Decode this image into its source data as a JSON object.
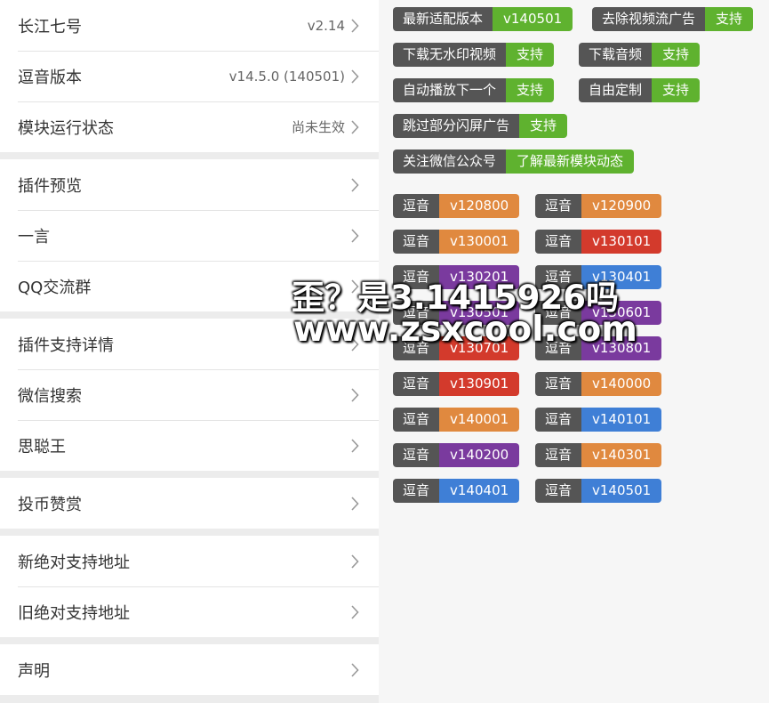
{
  "left_list": {
    "groups": [
      [
        {
          "label": "长江七号",
          "value": "v2.14"
        },
        {
          "label": "逗音版本",
          "value": "v14.5.0 (140501)"
        },
        {
          "label": "模块运行状态",
          "value": "尚未生效"
        }
      ],
      [
        {
          "label": "插件预览",
          "value": ""
        },
        {
          "label": "一言",
          "value": ""
        },
        {
          "label": "QQ交流群",
          "value": ""
        }
      ],
      [
        {
          "label": "插件支持详情",
          "value": ""
        },
        {
          "label": "微信搜索",
          "value": ""
        },
        {
          "label": "思聪王",
          "value": ""
        }
      ],
      [
        {
          "label": "投币赞赏",
          "value": ""
        }
      ],
      [
        {
          "label": "新绝对支持地址",
          "value": ""
        },
        {
          "label": "旧绝对支持地址",
          "value": ""
        }
      ],
      [
        {
          "label": "声明",
          "value": ""
        }
      ]
    ],
    "chevron_icon": "chevron-right-icon"
  },
  "feature_badges": [
    {
      "key": "最新适配版本",
      "value": "v140501",
      "color": "#5fb22f"
    },
    {
      "key": "去除视频流广告",
      "value": "支持",
      "color": "#5fb22f"
    },
    {
      "key": "下载无水印视频",
      "value": "支持",
      "color": "#5fb22f"
    },
    {
      "key": "下载音频",
      "value": "支持",
      "color": "#5fb22f"
    },
    {
      "key": "自动播放下一个",
      "value": "支持",
      "color": "#5fb22f"
    },
    {
      "key": "自由定制",
      "value": "支持",
      "color": "#5fb22f"
    },
    {
      "key": "跳过部分闪屏广告",
      "value": "支持",
      "color": "#5fb22f"
    },
    {
      "key": "关注微信公众号",
      "value": "了解最新模块动态",
      "color": "#5fb22f"
    }
  ],
  "version_badges": [
    {
      "key": "逗音",
      "value": "v120800",
      "color": "#e0893f"
    },
    {
      "key": "逗音",
      "value": "v120900",
      "color": "#e0893f"
    },
    {
      "key": "逗音",
      "value": "v130001",
      "color": "#e0893f"
    },
    {
      "key": "逗音",
      "value": "v130101",
      "color": "#d33a2c"
    },
    {
      "key": "逗音",
      "value": "v130201",
      "color": "#7a3a9e"
    },
    {
      "key": "逗音",
      "value": "v130401",
      "color": "#3f7fd6"
    },
    {
      "key": "逗音",
      "value": "v130501",
      "color": "#7a3a9e"
    },
    {
      "key": "逗音",
      "value": "v130601",
      "color": "#7a3a9e"
    },
    {
      "key": "逗音",
      "value": "v130701",
      "color": "#d33a2c"
    },
    {
      "key": "逗音",
      "value": "v130801",
      "color": "#7a3a9e"
    },
    {
      "key": "逗音",
      "value": "v130901",
      "color": "#d33a2c"
    },
    {
      "key": "逗音",
      "value": "v140000",
      "color": "#e0893f"
    },
    {
      "key": "逗音",
      "value": "v140001",
      "color": "#e0893f"
    },
    {
      "key": "逗音",
      "value": "v140101",
      "color": "#3f7fd6"
    },
    {
      "key": "逗音",
      "value": "v140200",
      "color": "#7a3a9e"
    },
    {
      "key": "逗音",
      "value": "v140301",
      "color": "#e0893f"
    },
    {
      "key": "逗音",
      "value": "v140401",
      "color": "#3f7fd6"
    },
    {
      "key": "逗音",
      "value": "v140501",
      "color": "#3f7fd6"
    }
  ],
  "watermark": {
    "line1": "歪？是3.1415926吗",
    "line2": "www.zsxcool.com"
  }
}
